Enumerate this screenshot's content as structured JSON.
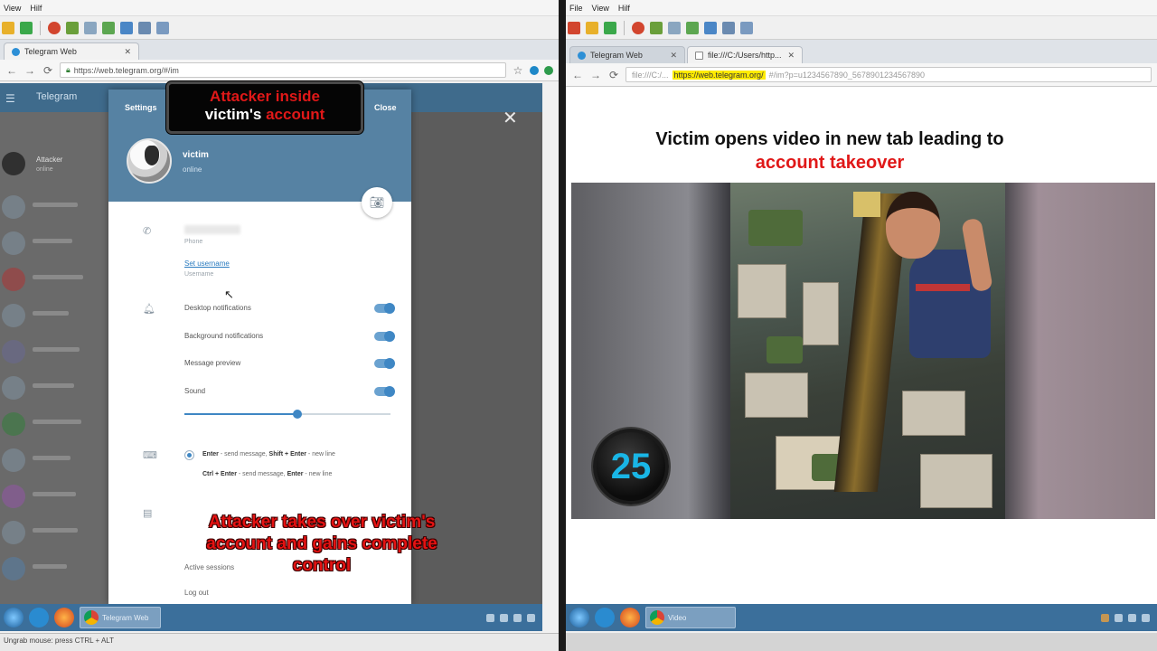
{
  "left_vm": {
    "menu": [
      "View",
      "Hilf"
    ],
    "browser": {
      "tab_title": "Telegram Web",
      "address": "https://web.telegram.org/#/im"
    },
    "telegram": {
      "header_title": "Telegram",
      "contact_name": "Attacker",
      "contact_sub": "online"
    },
    "settings": {
      "title": "Settings",
      "close": "Close",
      "profile_name": "victim",
      "profile_status": "online",
      "phone_label": "Phone",
      "username_link": "Set username",
      "username_label": "Username",
      "options": [
        "Desktop notifications",
        "Background notifications",
        "Message preview",
        "Sound"
      ],
      "sound_level": 0.55,
      "send_options": [
        {
          "key": "Enter",
          "a": " - send message, ",
          "key2": "Shift + Enter",
          "b": " - new line",
          "selected": true
        },
        {
          "key": "Ctrl + Enter",
          "a": " - send message, ",
          "key2": "Enter",
          "b": " - new line",
          "selected": false
        }
      ],
      "active_sessions": "Active sessions",
      "log_out": "Log out"
    },
    "callout": {
      "line1": "Attacker inside",
      "line2_white": "victim's ",
      "line2_red": "account"
    },
    "overlay": "Attacker takes over victim's account and gains complete control",
    "taskbar_app": "Telegram Web",
    "status_text": "Ungrab mouse: press CTRL + ALT"
  },
  "right_vm": {
    "menu": [
      "File",
      "View",
      "Hilf"
    ],
    "browser": {
      "tab1_title": "Telegram Web",
      "tab2_title": "file:///C:/Users/http...",
      "address_prefix": "file:///C:/...",
      "address_highlight": "https://web.telegram.org/",
      "address_rest": "#/im?p=u1234567890_5678901234567890"
    },
    "page": {
      "title_line1": "Victim opens video in new tab leading to",
      "title_line2": "account takeover",
      "counter": "25"
    },
    "taskbar_app": "Video"
  },
  "colors": {
    "accent_red": "#e01818",
    "telegram_blue": "#5682a3",
    "counter_cyan": "#19b6e6",
    "address_highlight": "#ffeb00"
  }
}
